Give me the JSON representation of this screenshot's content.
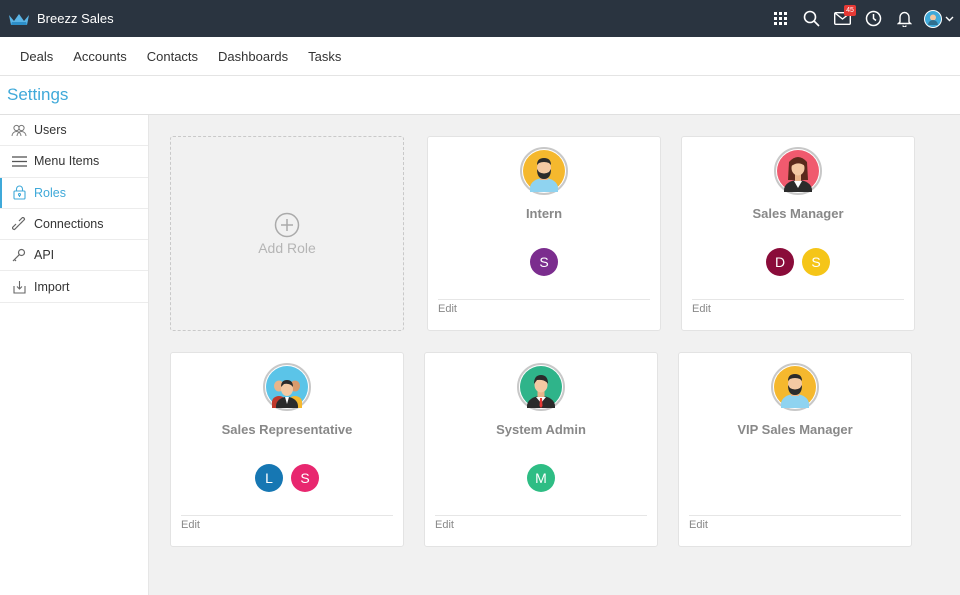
{
  "app": {
    "name": "Breezz Sales"
  },
  "topbar": {
    "icons": [
      "apps-grid-icon",
      "search-icon",
      "mail-icon",
      "clock-icon",
      "bell-icon",
      "user-avatar"
    ],
    "mail_badge": "45"
  },
  "nav": {
    "items": [
      "Deals",
      "Accounts",
      "Contacts",
      "Dashboards",
      "Tasks"
    ]
  },
  "settings": {
    "title": "Settings"
  },
  "sidebar": {
    "items": [
      {
        "label": "Users",
        "icon": "users-icon"
      },
      {
        "label": "Menu Items",
        "icon": "menu-lines-icon"
      },
      {
        "label": "Roles",
        "icon": "lock-icon",
        "active": true
      },
      {
        "label": "Connections",
        "icon": "link-icon"
      },
      {
        "label": "API",
        "icon": "key-icon"
      },
      {
        "label": "Import",
        "icon": "import-icon"
      }
    ]
  },
  "add_role": {
    "label": "Add Role"
  },
  "roles": [
    {
      "title": "Intern",
      "avatar": "bearded-man-avatar",
      "edit": "Edit",
      "members": [
        {
          "initial": "S",
          "color": "#7b2d8e"
        }
      ]
    },
    {
      "title": "Sales Manager",
      "avatar": "woman-avatar",
      "edit": "Edit",
      "members": [
        {
          "initial": "D",
          "color": "#8a0c3a"
        },
        {
          "initial": "S",
          "color": "#f5c518"
        }
      ]
    },
    {
      "title": "Sales Representative",
      "avatar": "team-avatar",
      "edit": "Edit",
      "members": [
        {
          "initial": "L",
          "color": "#1677b3"
        },
        {
          "initial": "S",
          "color": "#e8276f"
        }
      ]
    },
    {
      "title": "System Admin",
      "avatar": "man-tie-avatar",
      "edit": "Edit",
      "members": [
        {
          "initial": "M",
          "color": "#2ebd84"
        }
      ]
    },
    {
      "title": "VIP Sales Manager",
      "avatar": "bearded-man-avatar",
      "edit": "Edit",
      "members": []
    }
  ],
  "colors": {
    "topbar": "#2a3440",
    "accent": "#3fa9d9"
  }
}
